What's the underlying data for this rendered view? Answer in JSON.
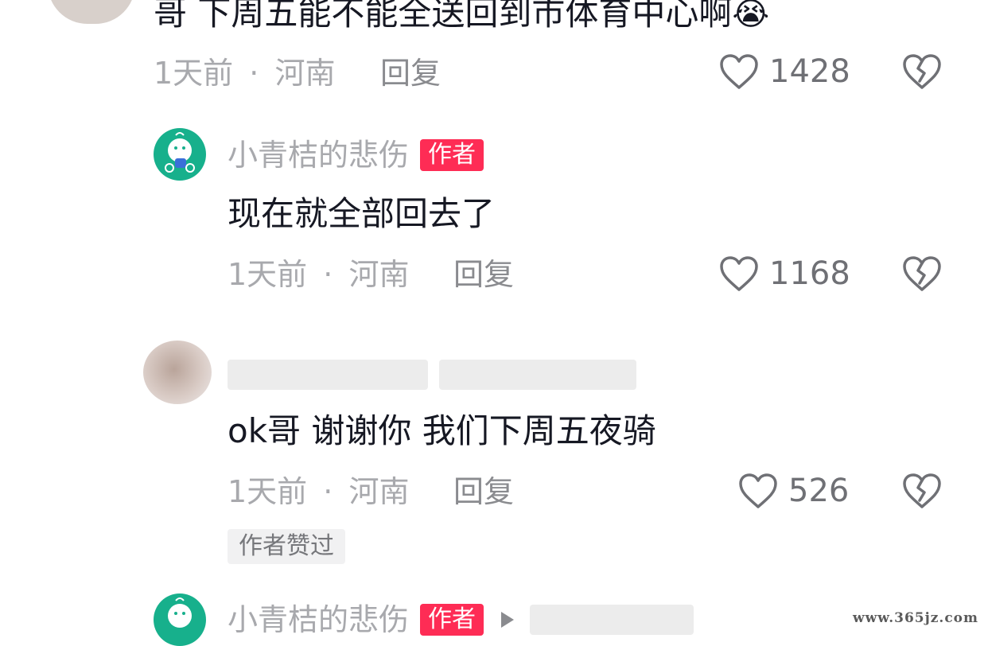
{
  "comments": [
    {
      "text": "哥 下周五能不能全送回到市体育中心啊",
      "emoji": "😭",
      "time": "1天前",
      "location": "河南",
      "reply_label": "回复",
      "likes": "1428"
    },
    {
      "author": "小青桔的悲伤",
      "author_badge": "作者",
      "text": "现在就全部回去了",
      "time": "1天前",
      "location": "河南",
      "reply_label": "回复",
      "likes": "1168"
    },
    {
      "text": "ok哥 谢谢你 我们下周五夜骑",
      "time": "1天前",
      "location": "河南",
      "reply_label": "回复",
      "likes": "526",
      "liked_by_author_label": "作者赞过"
    },
    {
      "author": "小青桔的悲伤",
      "author_badge": "作者"
    }
  ],
  "meta_separator": "·",
  "watermark": "www.365jz.com",
  "colors": {
    "badge": "#fe2c55",
    "avatar": "#17b08c",
    "meta_text": "#a8a9ad"
  },
  "icons": {
    "like": "heart-outline-icon",
    "dislike": "broken-heart-icon",
    "reply_arrow": "triangle-right-icon"
  }
}
